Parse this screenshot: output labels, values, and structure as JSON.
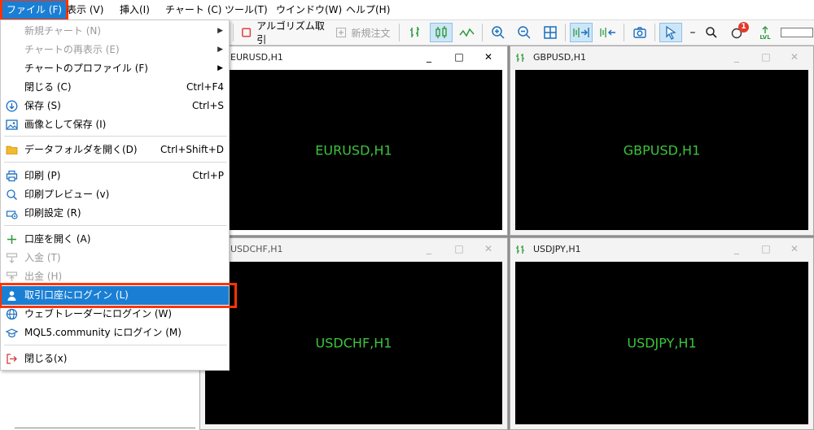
{
  "menubar": {
    "items": [
      {
        "label": "ファイル (F)"
      },
      {
        "label": "表示 (V)"
      },
      {
        "label": "挿入(I)"
      },
      {
        "label": "チャート (C)"
      },
      {
        "label": "ツール(T)"
      },
      {
        "label": "ウインドウ(W)"
      },
      {
        "label": "ヘルプ(H)"
      }
    ]
  },
  "toolbar": {
    "algo_label": "アルゴリズム取引",
    "new_order_label": "新規注文",
    "notification_count": "1",
    "lvl_label": "LVL"
  },
  "file_menu": {
    "items": [
      {
        "label": "新規チャート (N)",
        "shortcut": "",
        "disabled": true,
        "submenu": true
      },
      {
        "label": "チャートの再表示 (E)",
        "shortcut": "",
        "disabled": true,
        "submenu": true
      },
      {
        "label": "チャートのプロファイル (F)",
        "shortcut": "",
        "disabled": false,
        "submenu": true
      },
      {
        "label": "閉じる (C)",
        "shortcut": "Ctrl+F4"
      },
      {
        "label": "保存 (S)",
        "shortcut": "Ctrl+S"
      },
      {
        "label": "画像として保存 (I)",
        "shortcut": ""
      },
      {
        "label": "データフォルダを開く(D)",
        "shortcut": "Ctrl+Shift+D"
      },
      {
        "label": "印刷 (P)",
        "shortcut": "Ctrl+P"
      },
      {
        "label": "印刷プレビュー (v)",
        "shortcut": ""
      },
      {
        "label": "印刷設定 (R)",
        "shortcut": ""
      },
      {
        "label": "口座を開く (A)",
        "shortcut": ""
      },
      {
        "label": "入金 (T)",
        "shortcut": ""
      },
      {
        "label": "出金 (H)",
        "shortcut": ""
      },
      {
        "label": "取引口座にログイン (L)",
        "shortcut": ""
      },
      {
        "label": "ウェブトレーダーにログイン (W)",
        "shortcut": ""
      },
      {
        "label": "MQL5.community にログイン (M)",
        "shortcut": ""
      },
      {
        "label": "閉じる(x)",
        "shortcut": ""
      }
    ]
  },
  "charts": [
    {
      "title": "EURUSD,H1",
      "label": "EURUSD,H1"
    },
    {
      "title": "GBPUSD,H1",
      "label": "GBPUSD,H1"
    },
    {
      "title": "USDCHF,H1",
      "label": "USDCHF,H1"
    },
    {
      "title": "USDJPY,H1",
      "label": "USDJPY,H1"
    }
  ],
  "colors": {
    "menu_highlight": "#1a7fd4",
    "callout_border": "#ff3300",
    "chart_background": "#000000",
    "chart_text": "#3cc43c"
  }
}
